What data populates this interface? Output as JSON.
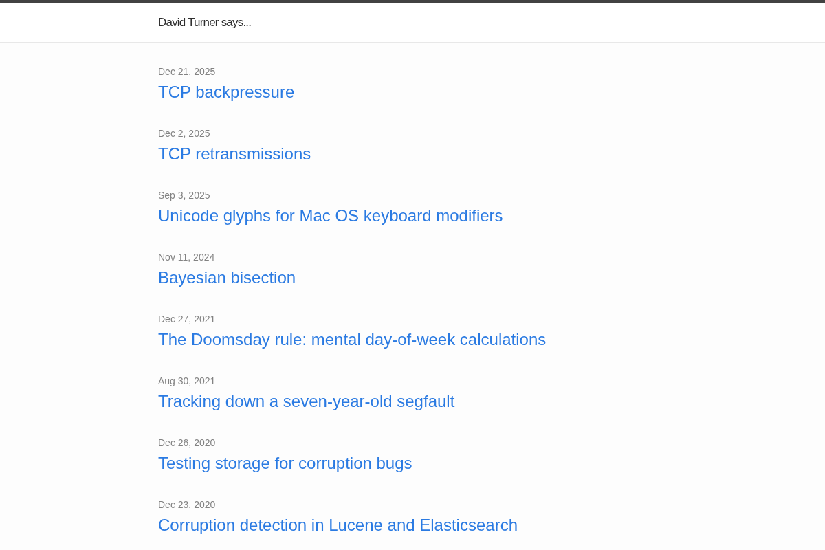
{
  "site": {
    "title": "David Turner says..."
  },
  "posts": [
    {
      "date": "Dec 21, 2025",
      "title": "TCP backpressure"
    },
    {
      "date": "Dec 2, 2025",
      "title": "TCP retransmissions"
    },
    {
      "date": "Sep 3, 2025",
      "title": "Unicode glyphs for Mac OS keyboard modifiers"
    },
    {
      "date": "Nov 11, 2024",
      "title": "Bayesian bisection"
    },
    {
      "date": "Dec 27, 2021",
      "title": "The Doomsday rule: mental day-of-week calculations"
    },
    {
      "date": "Aug 30, 2021",
      "title": "Tracking down a seven-year-old segfault"
    },
    {
      "date": "Dec 26, 2020",
      "title": "Testing storage for corruption bugs"
    },
    {
      "date": "Dec 23, 2020",
      "title": "Corruption detection in Lucene and Elasticsearch"
    }
  ]
}
